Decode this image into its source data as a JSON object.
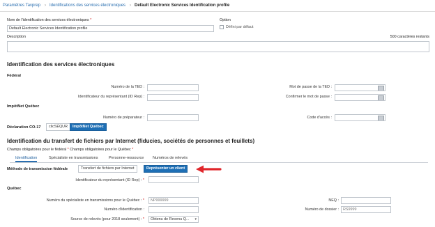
{
  "breadcrumb": {
    "items": [
      "Paramètres Taxprep",
      "Identifications des services électroniques",
      "Default Electronic Services Identification profile"
    ]
  },
  "profile": {
    "name_label": "Nom de l'identification des services électroniques",
    "name_value": "Default Electronic Services Identification profile",
    "option_label": "Option",
    "default_checkbox_label": "Défini par défaut",
    "description_label": "Description",
    "chars_remaining": "500 caractères restants"
  },
  "electronic_services": {
    "heading": "Identification des services électroniques",
    "federal_heading": "Fédéral",
    "ted_number_label": "Numéro de la TED :",
    "rep_id_label": "Identificateur du représentant (ID Rep) :",
    "ted_password_label": "Mot de passe de la TED :",
    "confirm_password_label": "Confirmer le mot de passe :",
    "impotnet_heading": "ImpôtNet Québec",
    "preparer_number_label": "Numéro de préparateur :",
    "access_code_label": "Code d'accès :",
    "declaration_label": "Déclaration CO-17",
    "declaration_options": [
      "clicSÉQUR",
      "ImpôtNet Québec"
    ]
  },
  "internet_transfer": {
    "heading": "Identification du transfert de fichiers par Internet (fiducies, sociétés de personnes et feuillets)",
    "required_note_federal": "Champs obligatoires pour le fédéral",
    "required_note_quebec": "Champs obligatoires pour le Québec",
    "tabs": [
      "Identification",
      "Spécialiste en transmissions",
      "Personne-ressource",
      "Numéros de relevés"
    ],
    "federal_method_label": "Méthode de transmission fédérale",
    "method_options": [
      "Transfert de fichiers par Internet",
      "Représenter un client"
    ],
    "rep_id_label": "Identificateur du représentant (ID Rep) :",
    "quebec_heading": "Québec",
    "specialist_number_label": "Numéro du spécialiste en transmissions pour le Québec :",
    "specialist_number_value": "NP999999",
    "neq_label": "NEQ :",
    "identification_number_label": "Numéro d'identification :",
    "file_number_label": "Numéro de dossier :",
    "file_number_value": "RS9999",
    "slip_source_label": "Source de relevés (pour 2018 seulement) :",
    "slip_source_value": "Obtenu de Revenu Q..."
  },
  "colors": {
    "link": "#2a6fb0",
    "accent": "#1e6fb5",
    "required": "#d01010",
    "arrow": "#e0262b"
  }
}
